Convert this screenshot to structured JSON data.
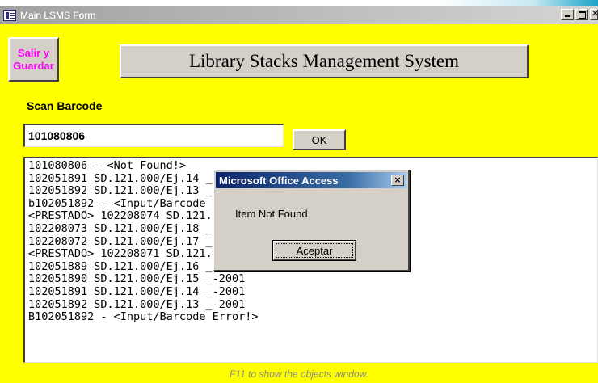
{
  "window": {
    "title": "Main LSMS Form"
  },
  "buttons": {
    "exit_line1": "Salir y",
    "exit_line2": "Guardar",
    "title_label": "Library Stacks Management System",
    "ok_label": "OK"
  },
  "scan": {
    "label": "Scan Barcode",
    "value": "101080806"
  },
  "list": {
    "items": [
      "101080806 - <Not Found!>",
      "102051891 SD.121.000/Ej.14 _-2001 <Out of Order>",
      "102051892 SD.121.000/Ej.13 _-2001 <Out of Order>",
      "b102051892 - <Input/Barcode Error!>",
      "<PRESTADO> 102208074 SD.121.000/Ej.19 _-2003",
      "102208073 SD.121.000/Ej.18 _-2003",
      "102208072 SD.121.000/Ej.17 _-2003",
      "<PRESTADO> 102208071 SD.121.000/Ej.16 _-2003",
      "102051889 SD.121.000/Ej.16 _-2001",
      "102051890 SD.121.000/Ej.15 _-2001",
      "102051891 SD.121.000/Ej.14 _-2001",
      "102051892 SD.121.000/Ej.13 _-2001",
      "B102051892 - <Input/Barcode Error!>"
    ]
  },
  "footer": {
    "hint": "F11 to show the objects window."
  },
  "dialog": {
    "title": "Microsoft Office Access",
    "close_glyph": "×",
    "message": "Item Not Found",
    "ok_label": "Aceptar"
  },
  "colors": {
    "form_background": "#ffff00",
    "exit_text": "#ff00ff",
    "dialog_title_bar": "#0a246a"
  }
}
